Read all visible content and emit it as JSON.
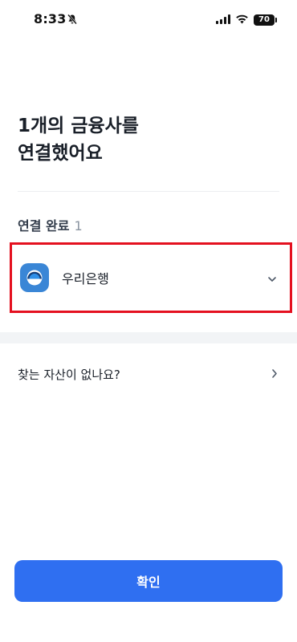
{
  "status_bar": {
    "time": "8:33",
    "battery": "70"
  },
  "title": {
    "line1": "1개의 금융사를",
    "line2": "연결했어요"
  },
  "connected_section": {
    "label": "연결 완료",
    "count": "1"
  },
  "bank": {
    "name": "우리은행",
    "logo_color": "#3a86d6"
  },
  "faq": {
    "label": "찾는 자산이 없나요?"
  },
  "confirm_button": {
    "label": "확인"
  },
  "colors": {
    "primary": "#2f6ff1",
    "highlight_border": "#e4101f"
  }
}
